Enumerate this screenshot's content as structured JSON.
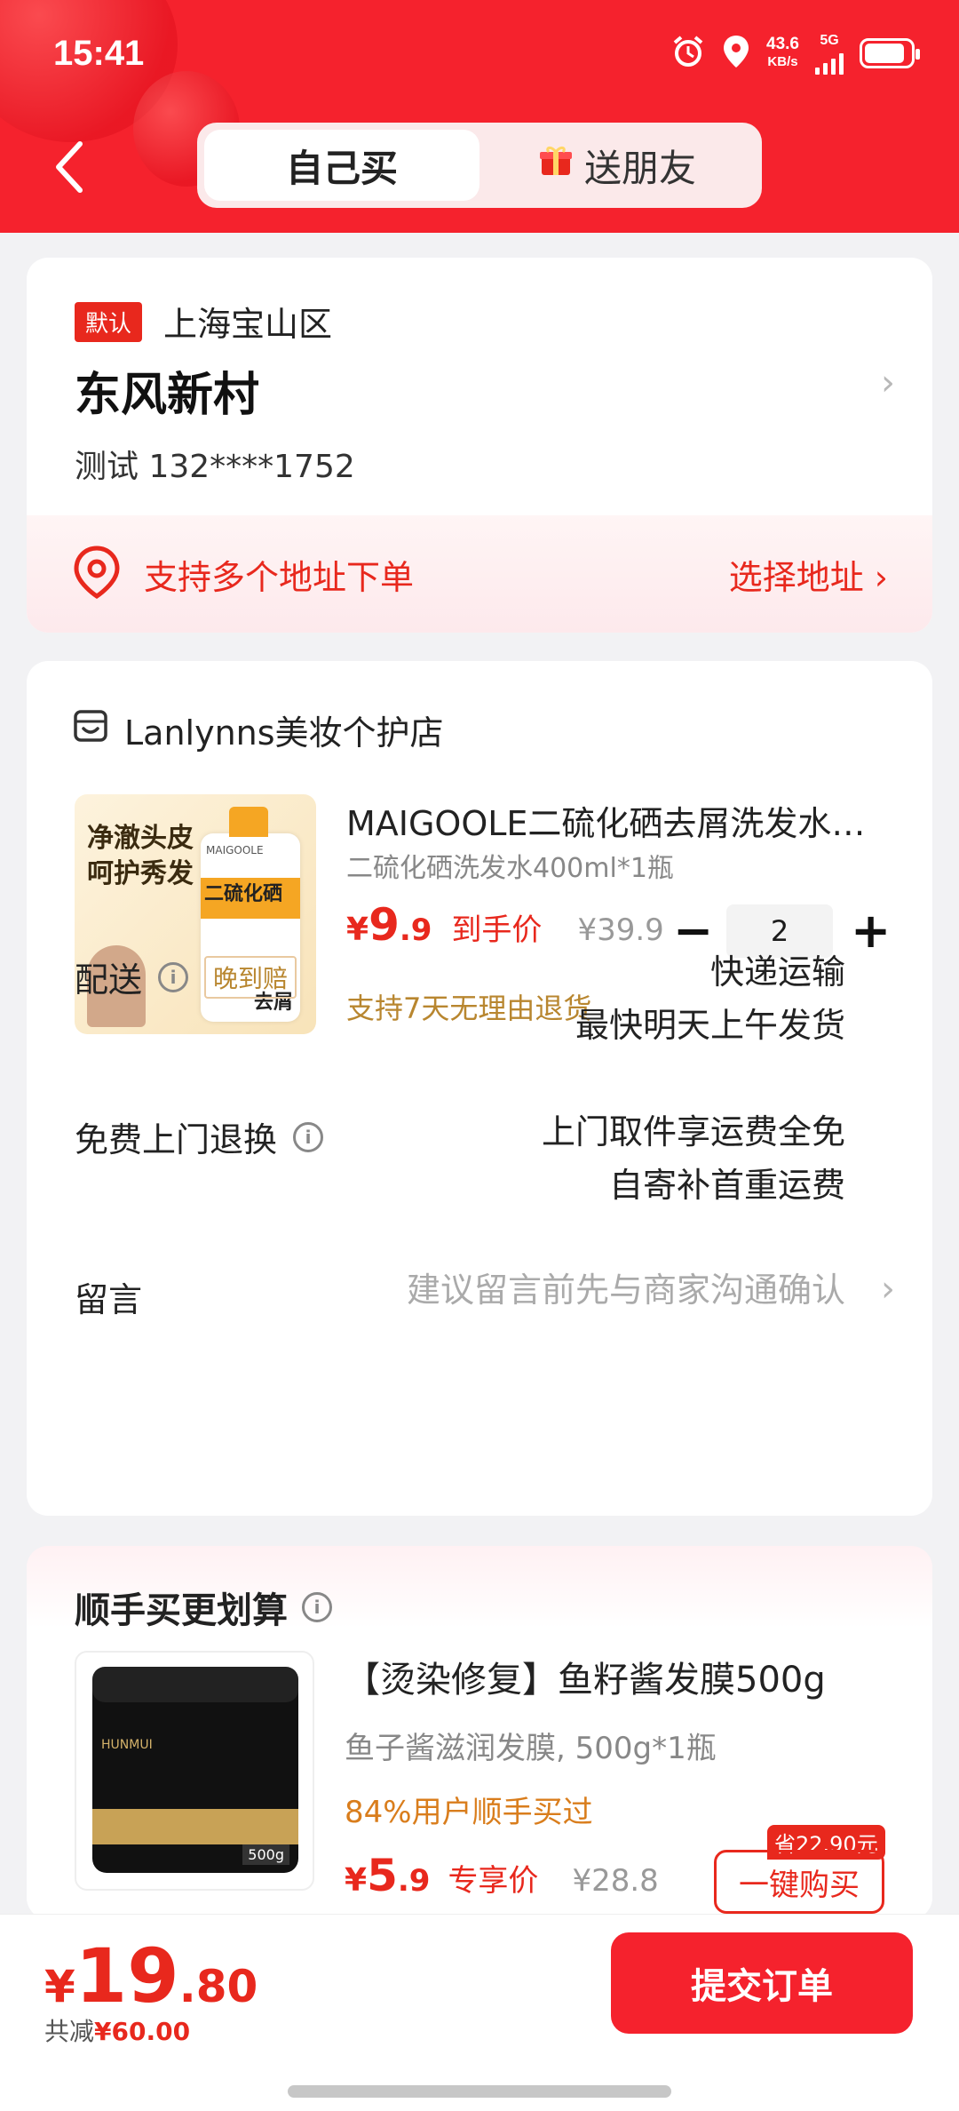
{
  "status_bar": {
    "time": "15:41",
    "net_speed": "43.6",
    "net_unit": "KB/s",
    "net_type": "5G"
  },
  "tabs": [
    {
      "label": "自己买"
    },
    {
      "label": "送朋友"
    }
  ],
  "address": {
    "default_tag": "默认",
    "region": "上海宝山区",
    "street": "东风新村",
    "contact": "测试  132****1752",
    "multi_address_text": "支持多个地址下单",
    "choose_address": "选择地址"
  },
  "order": {
    "shop_name": "Lanlynns美妆个护店",
    "product": {
      "name": "MAIGOOLE二硫化硒去屑洗发水…",
      "spec": "二硫化硒洗发水400ml*1瓶",
      "price_symbol": "¥",
      "price_int": "9",
      "price_dec": ".9",
      "price_tag": "到手价",
      "original_price": "¥39.9",
      "quantity": "2",
      "refund_note": "支持7天无理由退货",
      "image_text_1": "净澈头皮",
      "image_text_2": "呵护秀发",
      "image_text_3": "二硫化硒",
      "image_text_4": "去屑",
      "image_brand": "MAIGOOLE"
    },
    "delivery": {
      "label": "配送",
      "tag": "晚到赔",
      "value_line1": "快递运输",
      "value_line2": "最快明天上午发货"
    },
    "free_return": {
      "label": "免费上门退换",
      "value_line1": "上门取件享运费全免",
      "value_line2": "自寄补首重运费"
    },
    "memo": {
      "label": "留言",
      "placeholder": "建议留言前先与商家沟通确认"
    }
  },
  "addon": {
    "title": "顺手买更划算",
    "name": "【烫染修复】鱼籽酱发膜500g",
    "spec": "鱼子酱滋润发膜, 500g*1瓶",
    "popularity": "84%用户顺手买过",
    "price_symbol": "¥",
    "price_int": "5",
    "price_dec": ".9",
    "price_tag": "专享价",
    "original_price": "¥28.8",
    "save_tag": "省22.90元",
    "buy_button": "一键购买",
    "image_brand": "HUNMUI",
    "image_size": "500g"
  },
  "bottom": {
    "total_symbol": "¥",
    "total_int": "19",
    "total_dec": ".80",
    "saved_label": "共减",
    "saved_value": "¥60.00",
    "submit": "提交订单"
  },
  "colors": {
    "primary": "#f5222d",
    "accent_gold": "#b8862f"
  }
}
